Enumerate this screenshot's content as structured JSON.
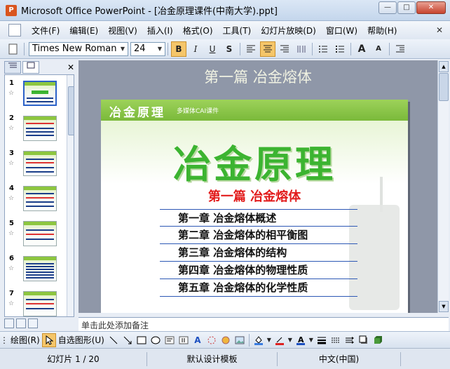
{
  "window": {
    "title": "Microsoft Office PowerPoint - [冶金原理课件(中南大学).ppt]",
    "app_icon": "P",
    "buttons": {
      "minimize": "—",
      "maximize": "□",
      "close": "✕"
    }
  },
  "menubar": {
    "items": [
      "文件(F)",
      "编辑(E)",
      "视图(V)",
      "插入(I)",
      "格式(O)",
      "工具(T)",
      "幻灯片放映(D)",
      "窗口(W)",
      "帮助(H)"
    ],
    "close_glyph": "✕"
  },
  "toolbar": {
    "font_name": "Times New Roman",
    "font_size": "24",
    "bold": "B",
    "italic": "I",
    "underline": "U",
    "shadow": "S",
    "grow": "A",
    "shrink": "A"
  },
  "panel": {
    "close_glyph": "✕",
    "slides": [
      {
        "num": "1"
      },
      {
        "num": "2"
      },
      {
        "num": "3"
      },
      {
        "num": "4"
      },
      {
        "num": "5"
      },
      {
        "num": "6"
      },
      {
        "num": "7"
      }
    ],
    "star_glyph": "☆"
  },
  "workspace": {
    "title": "第一篇 冶金熔体"
  },
  "slide": {
    "header": "冶金原理",
    "header_sub": "多媒体CAI课件",
    "big_title": "冶金原理",
    "subtitle": "第一篇  冶金熔体",
    "chapters": [
      "第一章  冶金熔体概述",
      "第二章  冶金熔体的相平衡图",
      "第三章  冶金熔体的结构",
      "第四章  冶金熔体的物理性质",
      "第五章  冶金熔体的化学性质"
    ]
  },
  "notes": {
    "placeholder": "单击此处添加备注"
  },
  "drawbar": {
    "draw_label": "绘图(R)",
    "autoshape_label": "自选图形(U)"
  },
  "statusbar": {
    "slide_pos": "幻灯片 1 / 20",
    "template": "默认设计模板",
    "language": "中文(中国)"
  },
  "colors": {
    "accent_green": "#3cb431",
    "header_green": "#8dc63f",
    "subtitle_red": "#e21b1b",
    "rule_blue": "#2d58b5"
  }
}
